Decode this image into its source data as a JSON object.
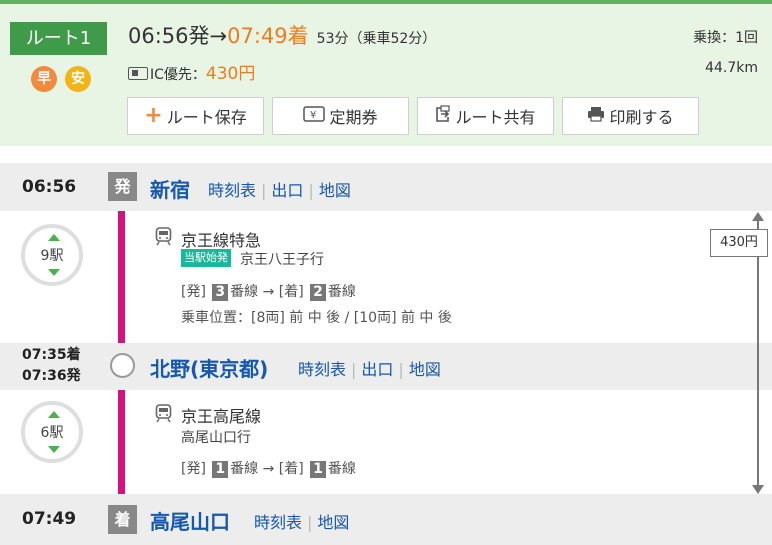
{
  "summary": {
    "route_label": "ルート1",
    "badge_fast": "早",
    "badge_cheap": "安",
    "dep_time": "06:56発",
    "arrow": "→",
    "arr_time": "07:49着",
    "duration": "53分（乗車52分）",
    "ic_label": "IC優先：",
    "fare": "430円",
    "transfers": "乗換：1回",
    "distance": "44.7km"
  },
  "buttons": {
    "save": "ルート保存",
    "pass": "定期券",
    "share": "ルート共有",
    "print": "印刷する"
  },
  "stations": [
    {
      "time": "06:56",
      "marker": "発",
      "name": "新宿",
      "links": [
        "時刻表",
        "出口",
        "地図"
      ]
    },
    {
      "time_arr": "07:35着",
      "time_dep": "07:36発",
      "name": "北野(東京都)",
      "links": [
        "時刻表",
        "出口",
        "地図"
      ]
    },
    {
      "time": "07:49",
      "marker": "着",
      "name": "高尾山口",
      "links": [
        "時刻表",
        "地図"
      ]
    }
  ],
  "segments": [
    {
      "stops": "9駅",
      "line": "京王線特急",
      "origin_badge": "当駅始発",
      "dest": "京王八王子行",
      "plat_dep_label": "[発]",
      "plat_dep_num": "3",
      "plat_unit": "番線",
      "plat_arrow": "→",
      "plat_arr_label": "[着]",
      "plat_arr_num": "2",
      "car_pos": "乗車位置：[8両] 前 中 後 / [10両] 前 中 後"
    },
    {
      "stops": "6駅",
      "line": "京王高尾線",
      "dest": "高尾山口行",
      "plat_dep_label": "[発]",
      "plat_dep_num": "1",
      "plat_unit": "番線",
      "plat_arrow": "→",
      "plat_arr_label": "[着]",
      "plat_arr_num": "1"
    }
  ],
  "fare_box": "430円",
  "colors": {
    "accent_green": "#3f9a4a",
    "line_magenta": "#d6117f",
    "fare_orange": "#f07a1e",
    "link_blue": "#1558b0"
  }
}
